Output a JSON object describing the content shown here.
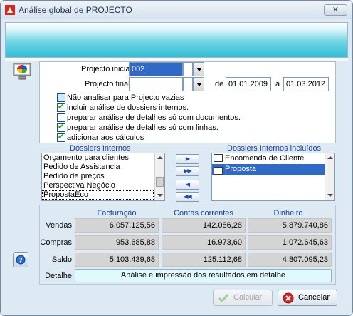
{
  "window": {
    "title": "Análise global de PROJECTO",
    "close_label": "✕"
  },
  "filters": {
    "projecto_inicial_label": "Projecto inicial",
    "projecto_inicial_value": "002",
    "projecto_final_label": "Projecto final",
    "projecto_final_value": "",
    "de_label": "de",
    "date_from": "01.01.2009",
    "a_label": "a",
    "date_to": "01.03.2012"
  },
  "options": [
    {
      "label": "Não analisar para Projecto vazias",
      "checked": false
    },
    {
      "label": "incluir análise de dossiers internos.",
      "checked": true
    },
    {
      "label": "preparar análise de detalhes só com documentos.",
      "checked": false
    },
    {
      "label": "preparar análise de detalhes só com linhas.",
      "checked": true
    },
    {
      "label": "adicionar aos cálculos",
      "checked": true
    }
  ],
  "dossiers": {
    "internos_header": "Dossiers Internos",
    "incluidos_header": "Dossiers Internos incluídos",
    "internos": [
      "Orçamento para clientes",
      "Pedido de Assistencia",
      "Pedido de preços",
      "Perspectiva Negócio",
      "PropostaEco"
    ],
    "incluidos": [
      "Encomenda de Cliente",
      "Proposta"
    ],
    "buttons": {
      "add_one": "▶",
      "add_all": "▶▶",
      "remove_one": "◀",
      "remove_all": "◀◀"
    }
  },
  "results": {
    "columns": [
      "Facturação",
      "Contas correntes",
      "Dinheiro"
    ],
    "rows": [
      {
        "label": "Vendas",
        "values": [
          "6.057.125,56",
          "142.086,28",
          "5.879.740,86"
        ]
      },
      {
        "label": "Compras",
        "values": [
          "953.685,88",
          "16.973,60",
          "1.072.645,63"
        ]
      },
      {
        "label": "Saldo",
        "values": [
          "5.103.439,68",
          "125.112,68",
          "4.807.095,23"
        ]
      }
    ],
    "detalhe_label": "Detalhe",
    "detalhe_button": "Análise e impressão dos resultados em detalhe"
  },
  "actions": {
    "calcular": "Calcular",
    "cancelar": "Cancelar"
  },
  "icons": {
    "app": "app-logo-icon",
    "monitor": "monitor-chart-icon",
    "help": "help-icon",
    "check": "check-icon",
    "cancel": "cancel-icon"
  },
  "colors": {
    "accent": "#3169c6",
    "banner": "#2fbdd4",
    "header_text": "#1b3f9c"
  }
}
